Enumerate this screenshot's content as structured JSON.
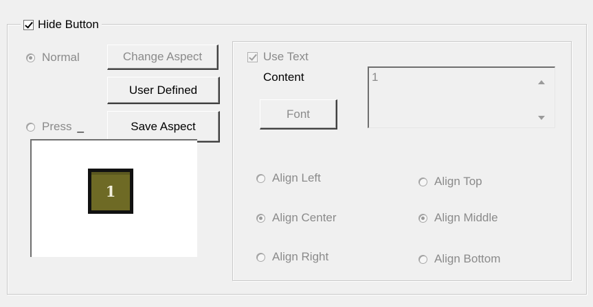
{
  "hide_button": {
    "label": "Hide Button",
    "checked": true
  },
  "state": {
    "normal_label": "Normal",
    "press_label": "Press",
    "press_suffix": "_"
  },
  "buttons": {
    "change_aspect": "Change Aspect",
    "user_defined": "User Defined",
    "save_aspect": "Save Aspect"
  },
  "preview": {
    "tile_label": "1"
  },
  "text_panel": {
    "use_text_label": "Use Text",
    "use_text_checked": true,
    "content_label": "Content",
    "content_value": "1",
    "font_button": "Font"
  },
  "alignment": {
    "horizontal": [
      "Align Left",
      "Align Center",
      "Align Right"
    ],
    "vertical": [
      "Align Top",
      "Align Middle",
      "Align Bottom"
    ],
    "selected_horizontal": "Align Center",
    "selected_vertical": "Align Middle"
  }
}
